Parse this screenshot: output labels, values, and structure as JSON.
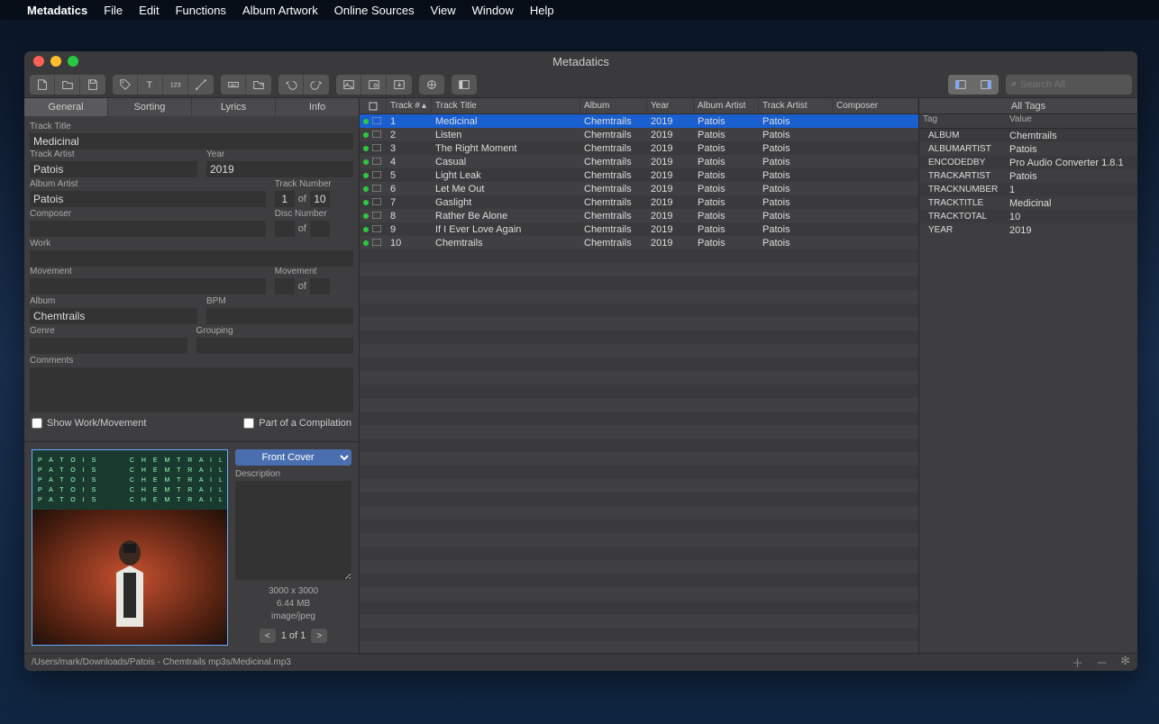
{
  "menubar": {
    "app_name": "Metadatics",
    "items": [
      "File",
      "Edit",
      "Functions",
      "Album Artwork",
      "Online Sources",
      "View",
      "Window",
      "Help"
    ]
  },
  "window": {
    "title": "Metadatics"
  },
  "search": {
    "placeholder": "Search All"
  },
  "tabs": [
    "General",
    "Sorting",
    "Lyrics",
    "Info"
  ],
  "form": {
    "track_title_label": "Track Title",
    "track_title": "Medicinal",
    "track_artist_label": "Track Artist",
    "track_artist": "Patois",
    "year_label": "Year",
    "year": "2019",
    "album_artist_label": "Album Artist",
    "album_artist": "Patois",
    "track_number_label": "Track Number",
    "track_number": "1",
    "track_total": "10",
    "composer_label": "Composer",
    "composer": "",
    "disc_number_label": "Disc Number",
    "disc_number": "",
    "disc_total": "",
    "work_label": "Work",
    "work": "",
    "movement_label": "Movement",
    "movement": "",
    "movement_num_label": "Movement",
    "movement_num": "",
    "movement_total": "",
    "album_label": "Album",
    "album": "Chemtrails",
    "bpm_label": "BPM",
    "bpm": "",
    "genre_label": "Genre",
    "genre": "",
    "grouping_label": "Grouping",
    "grouping": "",
    "comments_label": "Comments",
    "comments": "",
    "of_label": "of",
    "show_work_label": "Show Work/Movement",
    "compilation_label": "Part of a Compilation"
  },
  "artwork": {
    "cover_type": "Front Cover",
    "description_label": "Description",
    "dimensions": "3000 x 3000",
    "size": "6.44 MB",
    "mime": "image/jpeg",
    "page": "1 of 1",
    "art_text": "P A T O I S       C H E M T R A I L S\nP A T O I S       C H E M T R A I L S\nP A T O I S       C H E M T R A I L S\nP A T O I S       C H E M T R A I L S\nP A T O I S       C H E M T R A I L S"
  },
  "table": {
    "headers": {
      "track_num": "Track #",
      "track_title": "Track Title",
      "album": "Album",
      "year": "Year",
      "album_artist": "Album Artist",
      "track_artist": "Track Artist",
      "composer": "Composer"
    },
    "rows": [
      {
        "num": "1",
        "title": "Medicinal",
        "album": "Chemtrails",
        "year": "2019",
        "aartist": "Patois",
        "tartist": "Patois",
        "comp": "",
        "selected": true
      },
      {
        "num": "2",
        "title": "Listen",
        "album": "Chemtrails",
        "year": "2019",
        "aartist": "Patois",
        "tartist": "Patois",
        "comp": ""
      },
      {
        "num": "3",
        "title": "The Right Moment",
        "album": "Chemtrails",
        "year": "2019",
        "aartist": "Patois",
        "tartist": "Patois",
        "comp": ""
      },
      {
        "num": "4",
        "title": "Casual",
        "album": "Chemtrails",
        "year": "2019",
        "aartist": "Patois",
        "tartist": "Patois",
        "comp": ""
      },
      {
        "num": "5",
        "title": "Light Leak",
        "album": "Chemtrails",
        "year": "2019",
        "aartist": "Patois",
        "tartist": "Patois",
        "comp": ""
      },
      {
        "num": "6",
        "title": "Let Me Out",
        "album": "Chemtrails",
        "year": "2019",
        "aartist": "Patois",
        "tartist": "Patois",
        "comp": ""
      },
      {
        "num": "7",
        "title": "Gaslight",
        "album": "Chemtrails",
        "year": "2019",
        "aartist": "Patois",
        "tartist": "Patois",
        "comp": ""
      },
      {
        "num": "8",
        "title": "Rather Be Alone",
        "album": "Chemtrails",
        "year": "2019",
        "aartist": "Patois",
        "tartist": "Patois",
        "comp": ""
      },
      {
        "num": "9",
        "title": "If I Ever Love Again",
        "album": "Chemtrails",
        "year": "2019",
        "aartist": "Patois",
        "tartist": "Patois",
        "comp": ""
      },
      {
        "num": "10",
        "title": "Chemtrails",
        "album": "Chemtrails",
        "year": "2019",
        "aartist": "Patois",
        "tartist": "Patois",
        "comp": ""
      }
    ]
  },
  "tags": {
    "header": "All Tags",
    "tag_label": "Tag",
    "value_label": "Value",
    "rows": [
      {
        "tag": "ALBUM",
        "value": "Chemtrails"
      },
      {
        "tag": "ALBUMARTIST",
        "value": "Patois"
      },
      {
        "tag": "ENCODEDBY",
        "value": "Pro Audio Converter 1.8.1"
      },
      {
        "tag": "TRACKARTIST",
        "value": "Patois"
      },
      {
        "tag": "TRACKNUMBER",
        "value": "1"
      },
      {
        "tag": "TRACKTITLE",
        "value": "Medicinal"
      },
      {
        "tag": "TRACKTOTAL",
        "value": "10"
      },
      {
        "tag": "YEAR",
        "value": "2019"
      }
    ]
  },
  "status": {
    "path": "/Users/mark/Downloads/Patois - Chemtrails mp3s/Medicinal.mp3"
  }
}
